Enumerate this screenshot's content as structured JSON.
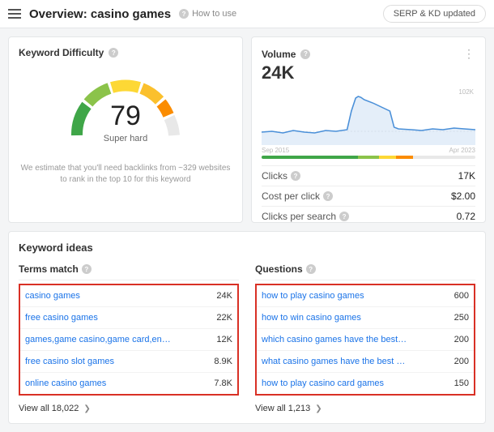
{
  "header": {
    "title": "Overview: casino games",
    "howto": "How to use",
    "pill": "SERP & KD updated"
  },
  "kd": {
    "title": "Keyword Difficulty",
    "score": "79",
    "label": "Super hard",
    "footnote1": "We estimate that you'll need backlinks from ~329 websites",
    "footnote2": "to rank in the top 10 for this keyword"
  },
  "volume": {
    "title": "Volume",
    "value": "24K",
    "ylab": "102K",
    "date_start": "Sep 2015",
    "date_end": "Apr 2023",
    "metrics": [
      {
        "label": "Clicks",
        "value": "17K"
      },
      {
        "label": "Cost per click",
        "value": "$2.00"
      },
      {
        "label": "Clicks per search",
        "value": "0.72"
      }
    ]
  },
  "ideas": {
    "title": "Keyword ideas",
    "terms_header": "Terms match",
    "questions_header": "Questions",
    "terms": [
      {
        "kw": "casino games",
        "v": "24K"
      },
      {
        "kw": "free casino games",
        "v": "22K"
      },
      {
        "kw": "games,game casino,game card,entertainment_",
        "v": "12K"
      },
      {
        "kw": "free casino slot games",
        "v": "8.9K"
      },
      {
        "kw": "online casino games",
        "v": "7.8K"
      }
    ],
    "terms_viewall": "View all 18,022",
    "questions": [
      {
        "kw": "how to play casino games",
        "v": "600"
      },
      {
        "kw": "how to win casino games",
        "v": "250"
      },
      {
        "kw": "which casino games have the best odds",
        "v": "200"
      },
      {
        "kw": "what casino games have the best odds",
        "v": "200"
      },
      {
        "kw": "how to play casino card games",
        "v": "150"
      }
    ],
    "questions_viewall": "View all 1,213"
  },
  "chart_data": {
    "type": "area",
    "title": "Volume",
    "xlabel": "",
    "ylabel": "",
    "ylim": [
      0,
      102
    ],
    "date_range": [
      "Sep 2015",
      "Apr 2023"
    ],
    "x": [
      0,
      5,
      10,
      15,
      20,
      25,
      30,
      35,
      40,
      42,
      44,
      45,
      46,
      48,
      52,
      56,
      60,
      62,
      64,
      70,
      75,
      80,
      85,
      90,
      95,
      100
    ],
    "values": [
      22,
      24,
      21,
      25,
      23,
      22,
      25,
      24,
      26,
      55,
      78,
      82,
      80,
      76,
      70,
      62,
      55,
      30,
      28,
      27,
      26,
      28,
      27,
      30,
      29,
      28
    ],
    "note": "values in K, spike mid-range"
  }
}
